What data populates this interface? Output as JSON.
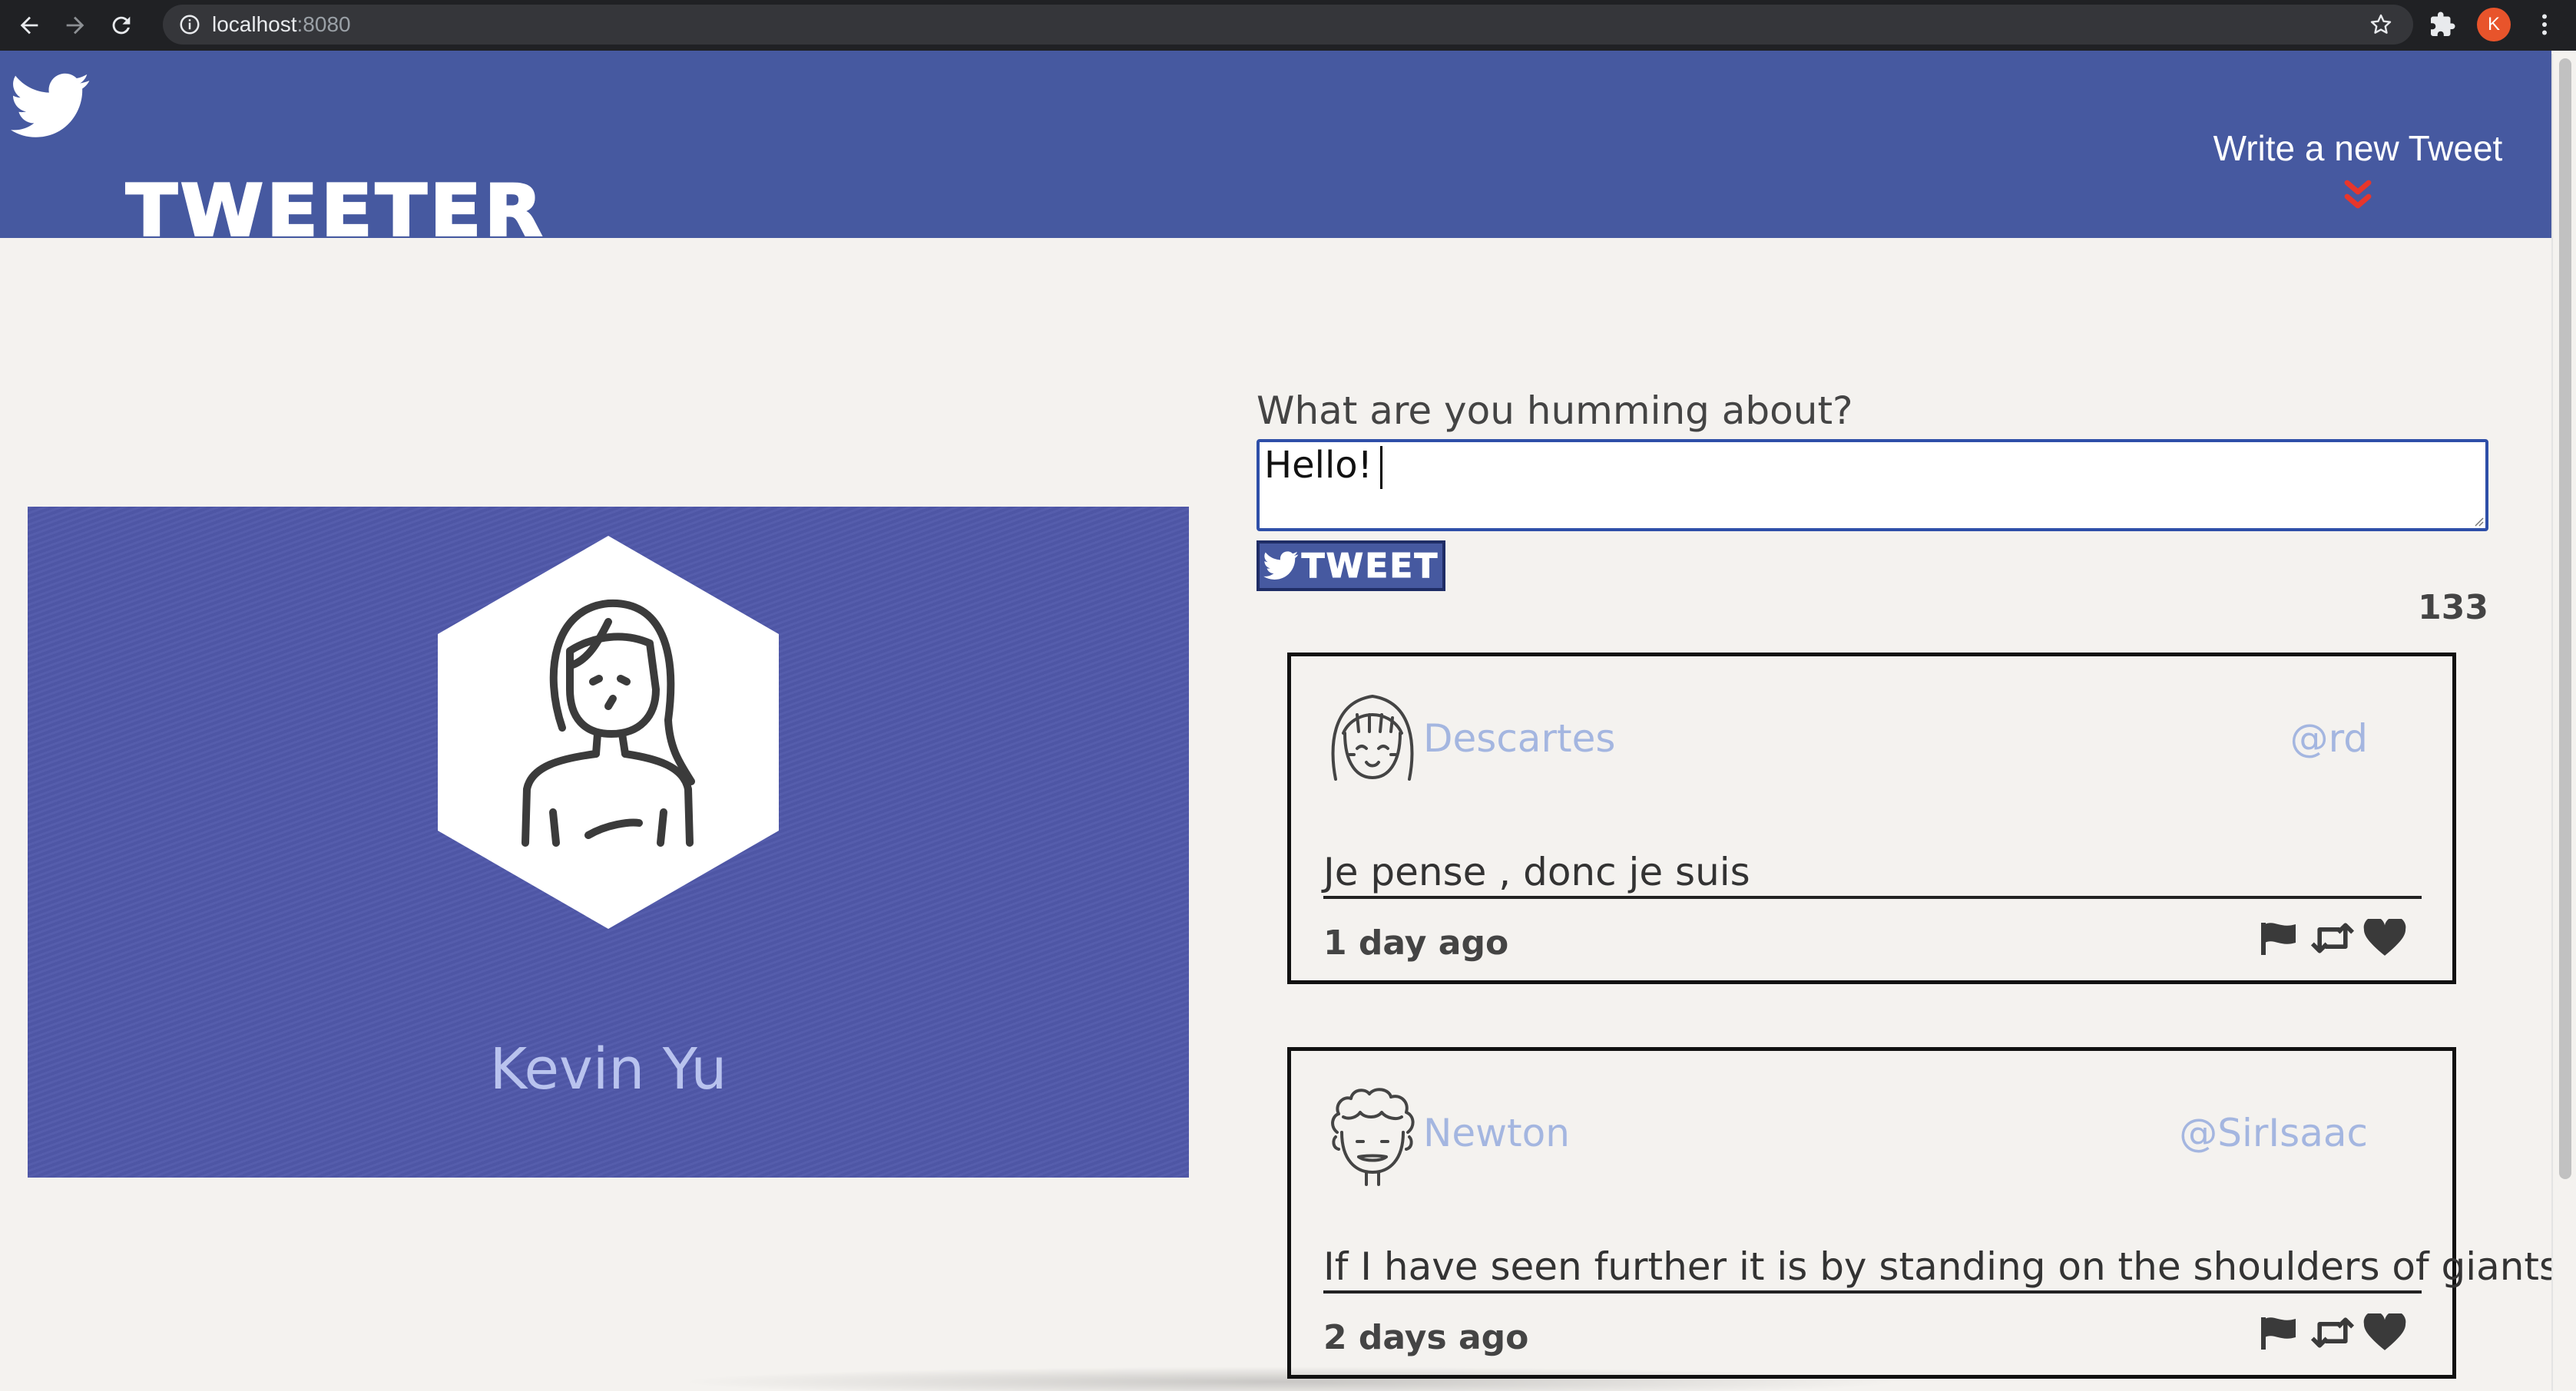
{
  "browser": {
    "url_host": "localhost",
    "url_port": ":8080",
    "profile_initial": "K"
  },
  "header": {
    "brand": "TWEETER",
    "compose_toggle_label": "Write a new Tweet",
    "chevron_color": "#e8362b"
  },
  "profile": {
    "name": "Kevin Yu",
    "background_color": "#5159aa"
  },
  "compose": {
    "heading": "What are you humming about?",
    "text_value": "Hello!",
    "submit_label": "TWEET",
    "char_counter": "133"
  },
  "tweets": [
    {
      "name": "Descartes",
      "handle": "@rd",
      "body": "Je pense , donc je suis",
      "time": "1 day ago",
      "avatar_icon": "girl-bangs-avatar-icon"
    },
    {
      "name": "Newton",
      "handle": "@SirIsaac",
      "body": "If I have seen further it is by standing on the shoulders of giants",
      "time": "2 days ago",
      "avatar_icon": "curly-hair-avatar-icon"
    }
  ],
  "icons": [
    "back-arrow-icon",
    "forward-arrow-icon",
    "reload-icon",
    "info-icon",
    "star-icon",
    "extension-puzzle-icon",
    "kebab-menu-icon",
    "twitter-bird-icon",
    "double-chevron-down-icon",
    "flag-icon",
    "retweet-icon",
    "heart-icon"
  ],
  "colors": {
    "header_blue": "#4659a0",
    "page_bg": "#f4f2ef",
    "name_blue": "#a4b6e0"
  }
}
